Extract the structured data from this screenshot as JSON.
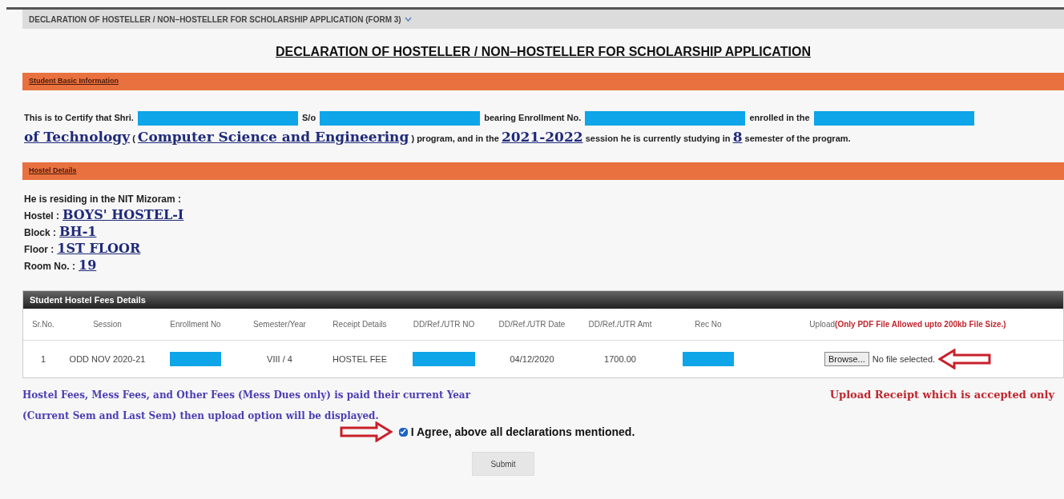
{
  "breadcrumb": {
    "title": "DECLARATION OF HOSTELLER / NON–HOSTELLER FOR SCHOLARSHIP APPLICATION (FORM 3)"
  },
  "heading": "DECLARATION OF HOSTELLER / NON–HOSTELLER FOR SCHOLARSHIP APPLICATION",
  "basic_info": {
    "title": "Student Basic Information",
    "segments": [
      {
        "kind": "text",
        "text": "This is to Certify that Shri."
      },
      {
        "kind": "redacted"
      },
      {
        "kind": "text",
        "text": "S/o"
      },
      {
        "kind": "redacted"
      },
      {
        "kind": "text",
        "text": "bearing Enrollment No."
      },
      {
        "kind": "redacted"
      },
      {
        "kind": "text",
        "text": "enrolled in the"
      },
      {
        "kind": "redacted"
      },
      {
        "kind": "link",
        "text": "of Technology"
      },
      {
        "kind": "text",
        "text": "("
      },
      {
        "kind": "link",
        "text": "Computer Science and Engineering"
      },
      {
        "kind": "text",
        "text": ") program, and in the"
      },
      {
        "kind": "link",
        "text": "2021-2022"
      },
      {
        "kind": "text",
        "text": "session he is currently studying in"
      },
      {
        "kind": "link",
        "text": "8"
      },
      {
        "kind": "text",
        "text": "semester of the program."
      }
    ]
  },
  "hostel": {
    "title": "Hostel Details",
    "intro": "He is residing in the NIT Mizoram :",
    "fields": [
      {
        "label": "Hostel :",
        "value": "BOYS' HOSTEL-I"
      },
      {
        "label": "Block :",
        "value": "BH-1"
      },
      {
        "label": "Floor :",
        "value": "1ST FLOOR"
      },
      {
        "label": "Room No. :",
        "value": "19"
      }
    ]
  },
  "fees": {
    "title": "Student Hostel Fees Details",
    "columns": [
      {
        "label": "Sr.No."
      },
      {
        "label": "Session"
      },
      {
        "label": "Enrollment No"
      },
      {
        "label": "Semester/Year"
      },
      {
        "label": "Receipt Details"
      },
      {
        "label": "DD/Ref./UTR NO"
      },
      {
        "label": "DD/Ref./UTR Date"
      },
      {
        "label": "DD/Ref./UTR Amt"
      },
      {
        "label": "Rec No"
      },
      {
        "label": "Upload",
        "note": "(Only PDF File Allowed upto 200kb File Size.)"
      }
    ],
    "rows": [
      {
        "cells": [
          {
            "kind": "text",
            "text": "1"
          },
          {
            "kind": "text",
            "text": "ODD NOV 2020-21"
          },
          {
            "kind": "redacted"
          },
          {
            "kind": "text",
            "text": "VIII / 4"
          },
          {
            "kind": "text",
            "text": "HOSTEL FEE"
          },
          {
            "kind": "redacted"
          },
          {
            "kind": "text",
            "text": "04/12/2020"
          },
          {
            "kind": "text",
            "text": "1700.00"
          },
          {
            "kind": "redacted"
          },
          {
            "kind": "upload",
            "button": "Browse...",
            "status": "No file selected."
          }
        ]
      }
    ]
  },
  "notes": {
    "left": [
      "Hostel Fees, Mess Fees, and Other Fees (Mess Dues only) is paid their current Year",
      "(Current Sem and Last Sem) then upload option will be displayed."
    ],
    "right": "Upload Receipt which is accepted only"
  },
  "agree": {
    "label": "I Agree, above all declarations mentioned.",
    "checked": true
  },
  "submit": "Submit"
}
